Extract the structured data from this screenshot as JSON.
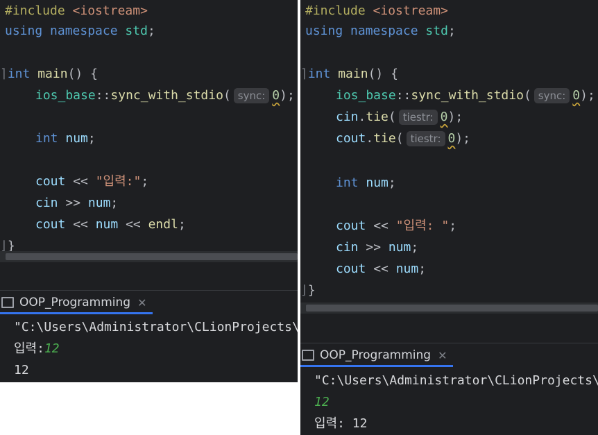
{
  "left": {
    "code": {
      "include": "#include",
      "header": "<iostream>",
      "using_kw": "using",
      "namespace_kw": "namespace",
      "std": "std",
      "semicolon": ";",
      "int_kw": "int",
      "main_fn": "main",
      "main_tail": "() {",
      "ios_base": "ios_base",
      "scope": "::",
      "sync_fn": "sync_with_stdio",
      "open_paren": "(",
      "sync_hint": "sync:",
      "zero": "0",
      "close_stmt": ");",
      "num_var": "num",
      "cout": "cout",
      "cin": "cin",
      "out_op": " << ",
      "in_op": " >> ",
      "prompt_str": "\"입력:\"",
      "endl": "endl",
      "close_brace": "}"
    },
    "run": {
      "tab_label": "OOP_Programming",
      "close_glyph": "✕",
      "lines": {
        "path": "\"C:\\Users\\Administrator\\CLionProjects\\",
        "prompt": "입력:",
        "input": "12",
        "output": "12"
      }
    }
  },
  "right": {
    "code": {
      "include": "#include",
      "header": "<iostream>",
      "using_kw": "using",
      "namespace_kw": "namespace",
      "std": "std",
      "semicolon": ";",
      "int_kw": "int",
      "main_fn": "main",
      "main_tail": "() {",
      "ios_base": "ios_base",
      "scope": "::",
      "sync_fn": "sync_with_stdio",
      "open_paren": "(",
      "sync_hint": "sync:",
      "tie_hint": "tiestr:",
      "tie_fn": "tie",
      "dot": ".",
      "zero": "0",
      "close_stmt": ");",
      "num_var": "num",
      "cout": "cout",
      "cin": "cin",
      "out_op": " << ",
      "in_op": " >> ",
      "prompt_str": "\"입력: \"",
      "close_brace": "}"
    },
    "run": {
      "tab_label": "OOP_Programming",
      "close_glyph": "✕",
      "lines": {
        "path": "\"C:\\Users\\Administrator\\CLionProjects\\",
        "input": "12",
        "prompt": "입력: ",
        "output": "12"
      }
    }
  }
}
